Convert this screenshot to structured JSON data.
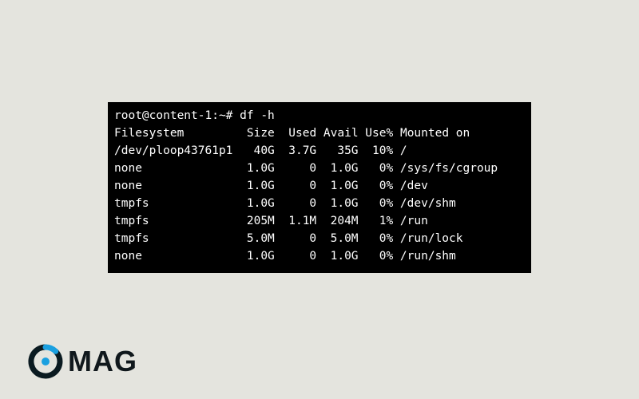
{
  "prompt": "root@content-1:~# ",
  "command": "df -h",
  "headers": {
    "filesystem": "Filesystem",
    "size": "Size",
    "used": "Used",
    "avail": "Avail",
    "usep": "Use%",
    "mounted": "Mounted on"
  },
  "rows": [
    {
      "fs": "/dev/ploop43761p1",
      "size": "40G",
      "used": "3.7G",
      "avail": "35G",
      "usep": "10%",
      "mnt": "/"
    },
    {
      "fs": "none",
      "size": "1.0G",
      "used": "0",
      "avail": "1.0G",
      "usep": "0%",
      "mnt": "/sys/fs/cgroup"
    },
    {
      "fs": "none",
      "size": "1.0G",
      "used": "0",
      "avail": "1.0G",
      "usep": "0%",
      "mnt": "/dev"
    },
    {
      "fs": "tmpfs",
      "size": "1.0G",
      "used": "0",
      "avail": "1.0G",
      "usep": "0%",
      "mnt": "/dev/shm"
    },
    {
      "fs": "tmpfs",
      "size": "205M",
      "used": "1.1M",
      "avail": "204M",
      "usep": "1%",
      "mnt": "/run"
    },
    {
      "fs": "tmpfs",
      "size": "5.0M",
      "used": "0",
      "avail": "5.0M",
      "usep": "0%",
      "mnt": "/run/lock"
    },
    {
      "fs": "none",
      "size": "1.0G",
      "used": "0",
      "avail": "1.0G",
      "usep": "0%",
      "mnt": "/run/shm"
    }
  ],
  "logo": {
    "text": "MAG"
  }
}
